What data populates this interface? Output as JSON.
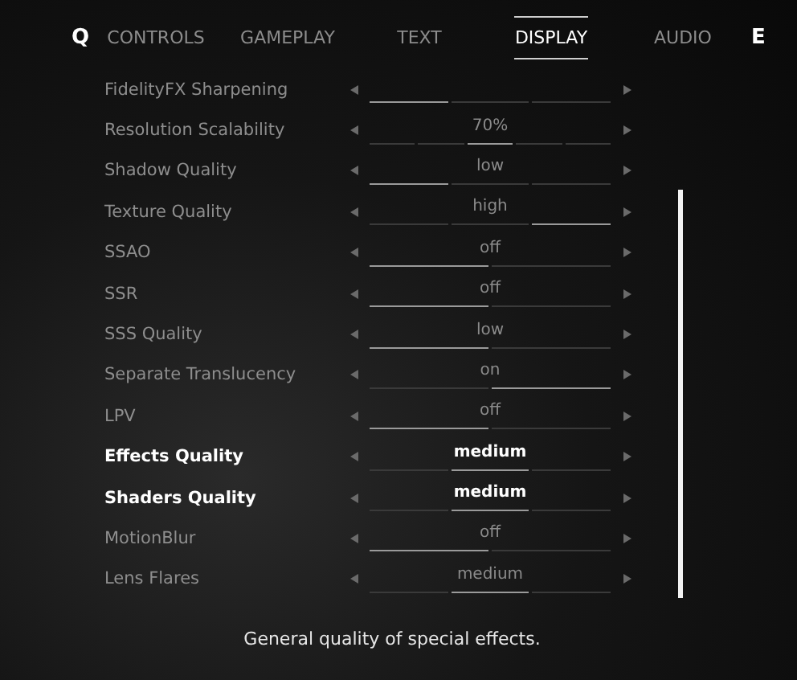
{
  "tabs": {
    "prev_key": "Q",
    "next_key": "E",
    "items": [
      {
        "label": "CONTROLS",
        "selected": false
      },
      {
        "label": "GAMEPLAY",
        "selected": false
      },
      {
        "label": "TEXT",
        "selected": false
      },
      {
        "label": "DISPLAY",
        "selected": true
      },
      {
        "label": "AUDIO",
        "selected": false
      }
    ]
  },
  "settings": [
    {
      "label": "FidelityFX Sharpening",
      "highlighted": false,
      "segments": [
        {
          "selected": true
        },
        {
          "selected": false
        },
        {
          "selected": false
        }
      ]
    },
    {
      "label": "Resolution Scalability",
      "value": "70%",
      "highlighted": false,
      "segments": [
        {
          "selected": false
        },
        {
          "selected": false
        },
        {
          "selected": true
        },
        {
          "selected": false
        },
        {
          "selected": false
        }
      ]
    },
    {
      "label": "Shadow Quality",
      "value": "low",
      "highlighted": false,
      "segments": [
        {
          "selected": true
        },
        {
          "selected": false
        },
        {
          "selected": false
        }
      ]
    },
    {
      "label": "Texture Quality",
      "value": "high",
      "highlighted": false,
      "segments": [
        {
          "selected": false
        },
        {
          "selected": false
        },
        {
          "selected": true
        }
      ]
    },
    {
      "label": "SSAO",
      "value": "off",
      "highlighted": false,
      "segments": [
        {
          "selected": true
        },
        {
          "selected": false
        }
      ]
    },
    {
      "label": "SSR",
      "value": "off",
      "highlighted": false,
      "segments": [
        {
          "selected": true
        },
        {
          "selected": false
        }
      ]
    },
    {
      "label": "SSS Quality",
      "value": "low",
      "highlighted": false,
      "segments": [
        {
          "selected": true
        },
        {
          "selected": false
        }
      ]
    },
    {
      "label": "Separate Translucency",
      "value": "on",
      "highlighted": false,
      "segments": [
        {
          "selected": false
        },
        {
          "selected": true
        }
      ]
    },
    {
      "label": "LPV",
      "value": "off",
      "highlighted": false,
      "segments": [
        {
          "selected": true
        },
        {
          "selected": false
        }
      ]
    },
    {
      "label": "Effects Quality",
      "value": "medium",
      "highlighted": true,
      "segments": [
        {
          "selected": false
        },
        {
          "selected": true
        },
        {
          "selected": false
        }
      ]
    },
    {
      "label": "Shaders Quality",
      "value": "medium",
      "highlighted": true,
      "segments": [
        {
          "selected": false
        },
        {
          "selected": true
        },
        {
          "selected": false
        }
      ]
    },
    {
      "label": "MotionBlur",
      "value": "off",
      "highlighted": false,
      "segments": [
        {
          "selected": true
        },
        {
          "selected": false
        }
      ]
    },
    {
      "label": "Lens Flares",
      "value": "medium",
      "highlighted": false,
      "segments": [
        {
          "selected": false
        },
        {
          "selected": true
        },
        {
          "selected": false
        }
      ]
    }
  ],
  "description": "General quality of special effects."
}
